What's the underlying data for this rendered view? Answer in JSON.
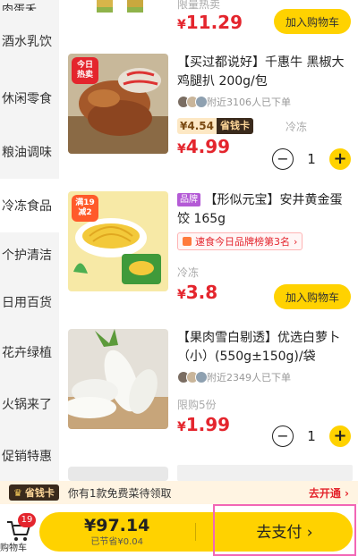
{
  "sidebar": {
    "items": [
      {
        "label": "肉蛋禾",
        "active": false
      },
      {
        "label": "酒水乳饮",
        "active": false
      },
      {
        "label": "休闲零食",
        "active": false
      },
      {
        "label": "粮油调味",
        "active": false
      },
      {
        "label": "冷冻食品",
        "active": true
      },
      {
        "label": "个护清洁",
        "active": false
      },
      {
        "label": "日用百货",
        "active": false
      },
      {
        "label": "花卉绿植",
        "active": false
      },
      {
        "label": "火锅来了",
        "active": false
      },
      {
        "label": "促销特惠",
        "active": false
      }
    ]
  },
  "products": [
    {
      "price_currency": "¥",
      "price_value": "11.29",
      "tag": "限量热卖",
      "add_label": "加入购物车"
    },
    {
      "title": "【买过都说好】千惠牛 黑椒大鸡腿扒 200g/包",
      "badge_line1": "今日",
      "badge_line2": "热卖",
      "sold": "附近3106人已下单",
      "member_price": "¥4.54",
      "member_card": "省钱卡",
      "storage": "冷冻",
      "price_currency": "¥",
      "price_value": "4.99",
      "qty": "1",
      "minus": "−",
      "plus": "+"
    },
    {
      "brand": "品牌",
      "title": "【形似元宝】安井黄金蛋饺 165g",
      "badge_line1": "满19",
      "badge_line2": "减2",
      "rank": "速食今日品牌榜第3名",
      "rank_arrow": "›",
      "storage": "冷冻",
      "price_currency": "¥",
      "price_value": "3.8",
      "add_label": "加入购物车"
    },
    {
      "title": "【果肉雪白剔透】优选白萝卜（小）(550g±150g)/袋",
      "sold": "附近2349人已下单",
      "limit": "限购5份",
      "price_currency": "¥",
      "price_value": "1.99",
      "qty": "1",
      "minus": "−",
      "plus": "+"
    }
  ],
  "promo": {
    "crown": "♛",
    "card": "省钱卡",
    "message": "你有1款免费菜待领取",
    "action": "去开通 ›"
  },
  "bottom": {
    "cart_count": "19",
    "cart_label": "购物车",
    "total": "¥97.14",
    "saved": "已节省¥0.04",
    "checkout": "去支付 ›"
  },
  "colors": {
    "accent_yellow": "#ffd200",
    "price_red": "#e4252d",
    "highlight_pink": "#f267b6"
  }
}
